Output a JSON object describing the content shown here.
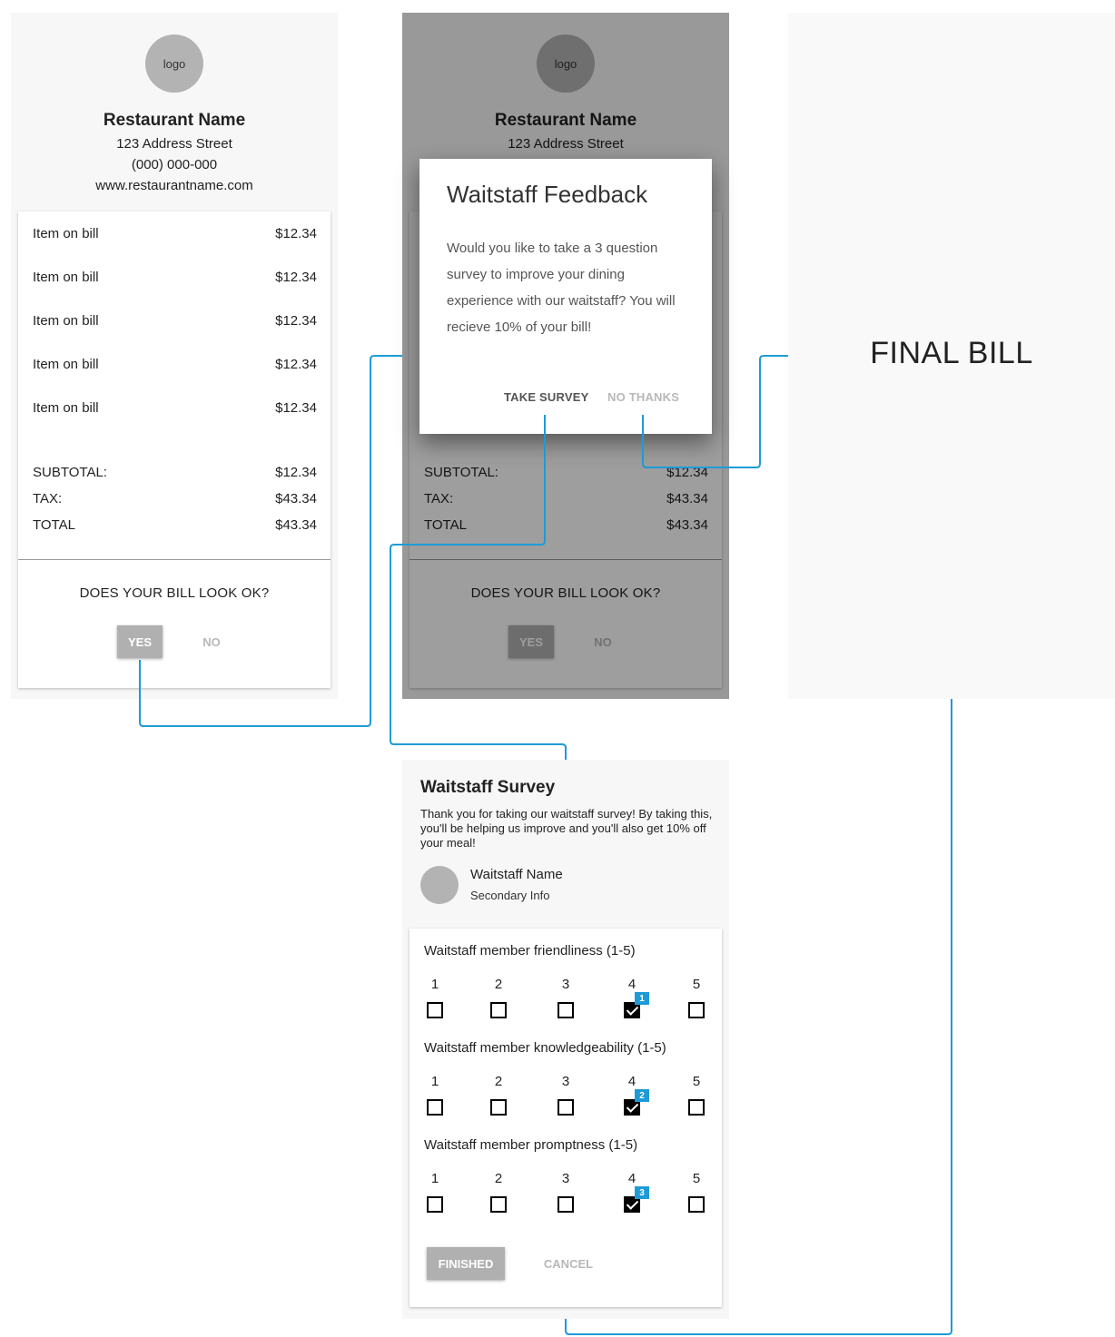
{
  "bill": {
    "logo_text": "logo",
    "restaurant_name": "Restaurant Name",
    "address": "123 Address Street",
    "phone": "(000) 000-000",
    "website": "www.restaurantname.com",
    "items": [
      {
        "name": "Item on bill",
        "price": "$12.34"
      },
      {
        "name": "Item on bill",
        "price": "$12.34"
      },
      {
        "name": "Item on bill",
        "price": "$12.34"
      },
      {
        "name": "Item on bill",
        "price": "$12.34"
      },
      {
        "name": "Item on bill",
        "price": "$12.34"
      }
    ],
    "subtotal_label": "SUBTOTAL:",
    "subtotal_value": "$12.34",
    "tax_label": "TAX:",
    "tax_value": "$43.34",
    "total_label": "TOTAL",
    "total_value": "$43.34",
    "question": "DOES YOUR BILL LOOK OK?",
    "yes_label": "YES",
    "no_label": "NO"
  },
  "dialog": {
    "title": "Waitstaff Feedback",
    "body": "Would you like to take a 3 question survey to improve your dining experience with our waitstaff? You will recieve 10% of your bill!",
    "take_survey_label": "TAKE SURVEY",
    "no_thanks_label": "NO THANKS"
  },
  "final": {
    "title": "FINAL BILL"
  },
  "survey": {
    "title": "Waitstaff Survey",
    "description": "Thank you for taking our waitstaff survey! By taking this, you'll be helping us improve and you'll also get 10% off your meal!",
    "waitstaff_name": "Waitstaff Name",
    "secondary_info": "Secondary Info",
    "scale": [
      "1",
      "2",
      "3",
      "4",
      "5"
    ],
    "questions": [
      {
        "label": "Waitstaff member friendliness (1-5)",
        "selected": 4,
        "badge": "1"
      },
      {
        "label": "Waitstaff member knowledgeability (1-5)",
        "selected": 4,
        "badge": "2"
      },
      {
        "label": "Waitstaff member promptness (1-5)",
        "selected": 4,
        "badge": "3"
      }
    ],
    "finished_label": "FINISHED",
    "cancel_label": "CANCEL"
  },
  "colors": {
    "connector": "#1e9bd7",
    "badge": "#1e9bd7",
    "raised_button": "#b0b0b0"
  }
}
